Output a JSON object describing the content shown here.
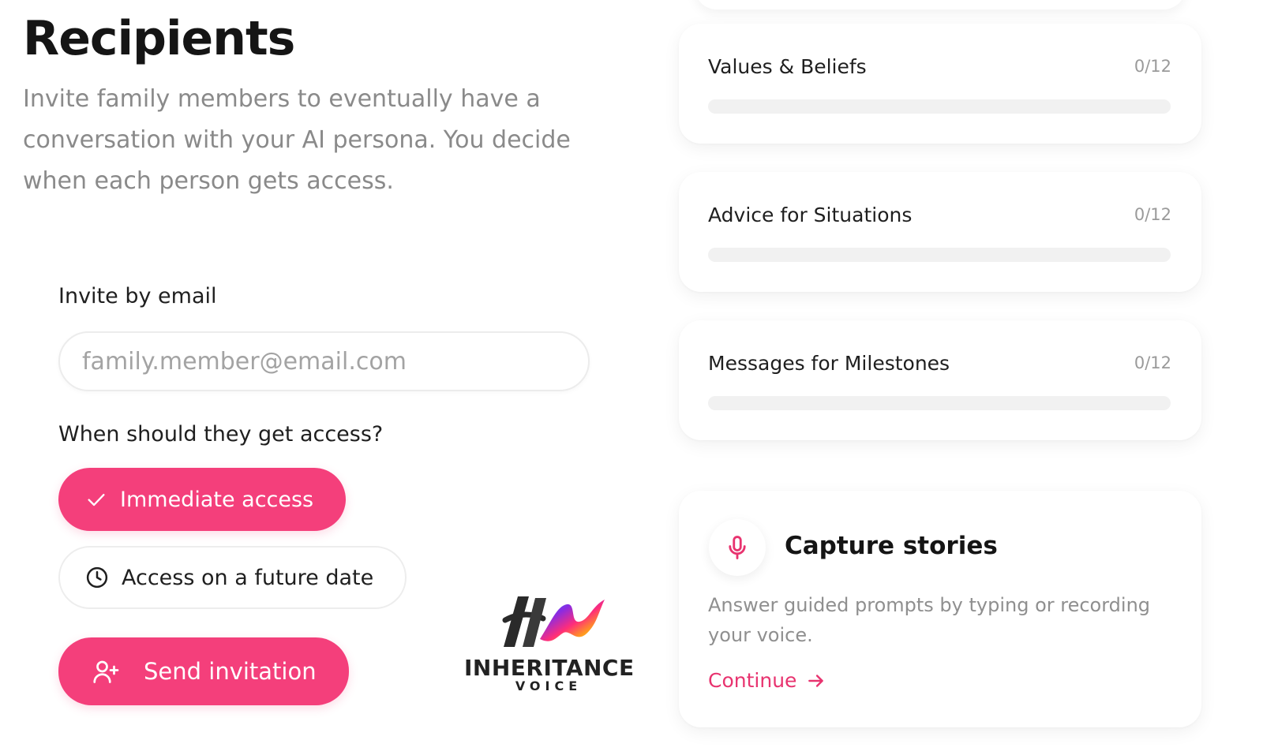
{
  "recipients": {
    "title": "Recipients",
    "description": "Invite family members to eventually have a conversation with your AI persona. You decide when each person gets access.",
    "invite_label": "Invite by email",
    "email_placeholder": "family.member@email.com",
    "email_value": "",
    "access_question": "When should they get access?",
    "access_options": [
      {
        "label": "Immediate access",
        "icon": "check-icon",
        "selected": true
      },
      {
        "label": "Access on a future date",
        "icon": "clock-icon",
        "selected": false
      }
    ],
    "send_button": {
      "label": "Send invitation",
      "icon": "user-plus-icon"
    }
  },
  "logo": {
    "wordmark": "INHERITANCE",
    "sub": "VOICE"
  },
  "categories": [
    {
      "title": "Values & Beliefs",
      "count": "0/12",
      "progress": 0
    },
    {
      "title": "Advice for Situations",
      "count": "0/12",
      "progress": 0
    },
    {
      "title": "Messages for Milestones",
      "count": "0/12",
      "progress": 0
    }
  ],
  "capture": {
    "icon": "microphone-icon",
    "title": "Capture stories",
    "description": "Answer guided prompts by typing or recording your voice.",
    "link_label": "Continue",
    "link_icon": "arrow-right-icon"
  },
  "colors": {
    "accent": "#f43f7b",
    "link": "#e8336f",
    "muted_text": "#8a8a8a"
  }
}
